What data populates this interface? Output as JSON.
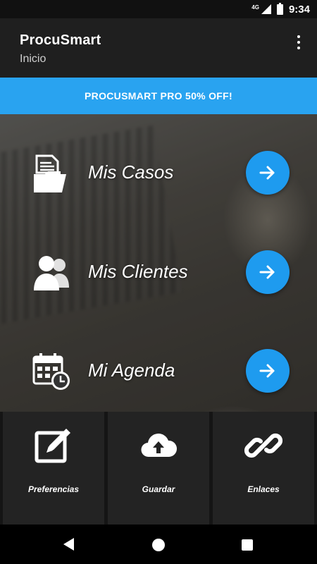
{
  "status_bar": {
    "network": "4G",
    "time": "9:34"
  },
  "app_bar": {
    "title": "ProcuSmart",
    "subtitle": "Inicio"
  },
  "promo": {
    "text": "PROCUSMART PRO 50% OFF!"
  },
  "menu": [
    {
      "label": "Mis Casos",
      "icon": "folder-documents-icon"
    },
    {
      "label": "Mis Clientes",
      "icon": "users-icon"
    },
    {
      "label": "Mi Agenda",
      "icon": "calendar-clock-icon"
    }
  ],
  "tiles": [
    {
      "label": "Preferencias",
      "icon": "edit-icon"
    },
    {
      "label": "Guardar",
      "icon": "cloud-upload-icon"
    },
    {
      "label": "Enlaces",
      "icon": "link-icon"
    }
  ],
  "colors": {
    "accent": "#29a3f0",
    "button": "#1e9bef",
    "app_bar": "#1f1f1f",
    "tile": "#232323"
  }
}
